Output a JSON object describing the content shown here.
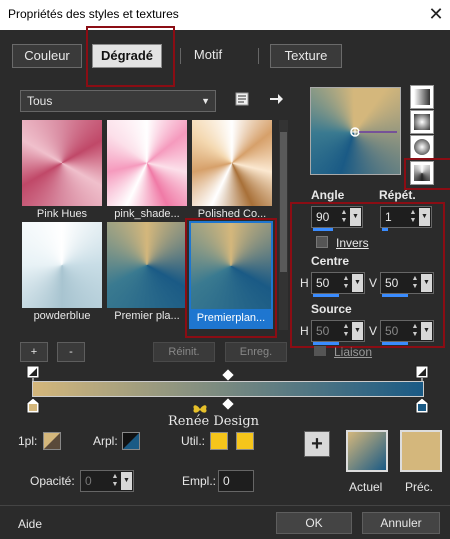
{
  "window": {
    "title": "Propriétés des styles et textures",
    "close": "✕"
  },
  "tabs": [
    {
      "label": "Couleur",
      "selected": false
    },
    {
      "label": "Dégradé",
      "selected": true
    },
    {
      "label": "Motif",
      "selected": false
    },
    {
      "label": "Texture",
      "selected": false
    }
  ],
  "category": {
    "value": "Tous"
  },
  "gradients": [
    {
      "label": "Pink Hues"
    },
    {
      "label": "pink_shade..."
    },
    {
      "label": "Polished Co..."
    },
    {
      "label": "powderblue"
    },
    {
      "label": "Premier pla..."
    },
    {
      "label": "Premierplan...",
      "selected": true
    }
  ],
  "list_buttons": {
    "add": "+",
    "remove": "-",
    "reset": "Réinit.",
    "save": "Enreg."
  },
  "angle": {
    "label": "Angle",
    "value": "90"
  },
  "repeat": {
    "label": "Répét.",
    "value": "1"
  },
  "invert": {
    "label": "Invers"
  },
  "centre": {
    "label": "Centre",
    "h_label": "H",
    "h": "50",
    "v_label": "V",
    "v": "50"
  },
  "source": {
    "label": "Source",
    "h_label": "H",
    "h": "50",
    "v_label": "V",
    "v": "50"
  },
  "link": {
    "label": "Liaison"
  },
  "watermark": {
    "text": "Renée Design"
  },
  "stop": {
    "first_label": "1pl:",
    "arpl_label": "Arpl:",
    "util_label": "Util.:",
    "opacity_label": "Opacité:",
    "opacity": "0",
    "empl_label": "Empl.:",
    "empl": "0"
  },
  "preview": {
    "current_label": "Actuel",
    "previous_label": "Préc.",
    "add": "+"
  },
  "footer": {
    "help": "Aide",
    "ok": "OK",
    "cancel": "Annuler"
  },
  "colors": {
    "blue": "#1a5a85",
    "gold": "#d4b77c",
    "accent": "#1e76d0",
    "highlight_red": "#8b0d14",
    "yellow": "#f5c51b"
  }
}
